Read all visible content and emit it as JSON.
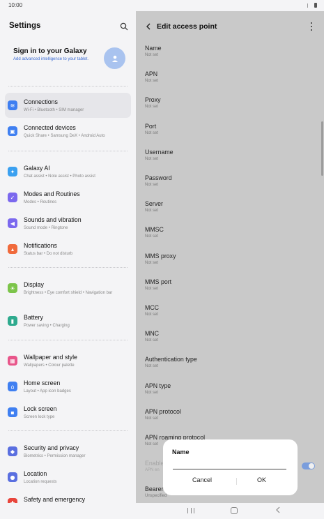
{
  "status": {
    "time": "10:00"
  },
  "left": {
    "title": "Settings",
    "profile": {
      "title": "Sign in to your Galaxy",
      "subtitle": "Add advanced intelligence to your tablet."
    },
    "items": [
      {
        "label": "Connections",
        "sub": "Wi-Fi • Bluetooth • SIM manager",
        "icon": "wifi-icon",
        "color": "#3f7ff1"
      },
      {
        "label": "Connected devices",
        "sub": "Quick Share • Samsung DeX • Android Auto",
        "icon": "devices-icon",
        "color": "#3f7ff1"
      },
      {
        "label": "Galaxy AI",
        "sub": "Chat assist • Note assist • Photo assist",
        "icon": "sparkle-icon",
        "color": "#3aa0f0"
      },
      {
        "label": "Modes and Routines",
        "sub": "Modes • Routines",
        "icon": "check-circle-icon",
        "color": "#7b68ee"
      },
      {
        "label": "Sounds and vibration",
        "sub": "Sound mode • Ringtone",
        "icon": "speaker-icon",
        "color": "#7b68ee"
      },
      {
        "label": "Notifications",
        "sub": "Status bar • Do not disturb",
        "icon": "bell-icon",
        "color": "#f06a3c"
      },
      {
        "label": "Display",
        "sub": "Brightness • Eye comfort shield • Navigation bar",
        "icon": "sun-icon",
        "color": "#7cc44a"
      },
      {
        "label": "Battery",
        "sub": "Power saving • Charging",
        "icon": "battery-icon",
        "color": "#2eaa8e"
      },
      {
        "label": "Wallpaper and style",
        "sub": "Wallpapers • Colour palette",
        "icon": "wallpaper-icon",
        "color": "#e8558a"
      },
      {
        "label": "Home screen",
        "sub": "Layout • App icon badges",
        "icon": "home-icon",
        "color": "#3f7ff1"
      },
      {
        "label": "Lock screen",
        "sub": "Screen lock type",
        "icon": "lock-icon",
        "color": "#3f7ff1"
      },
      {
        "label": "Security and privacy",
        "sub": "Biometrics • Permission manager",
        "icon": "shield-icon",
        "color": "#5a6fe0"
      },
      {
        "label": "Location",
        "sub": "Location requests",
        "icon": "location-icon",
        "color": "#5a6fe0"
      },
      {
        "label": "Safety and emergency",
        "sub": "",
        "icon": "emergency-icon",
        "color": "#e8453c"
      }
    ]
  },
  "right": {
    "title": "Edit access point",
    "fields": [
      {
        "label": "Name",
        "value": "Not set"
      },
      {
        "label": "APN",
        "value": "Not set"
      },
      {
        "label": "Proxy",
        "value": "Not set"
      },
      {
        "label": "Port",
        "value": "Not set"
      },
      {
        "label": "Username",
        "value": "Not set"
      },
      {
        "label": "Password",
        "value": "Not set"
      },
      {
        "label": "Server",
        "value": "Not set"
      },
      {
        "label": "MMSC",
        "value": "Not set"
      },
      {
        "label": "MMS proxy",
        "value": "Not set"
      },
      {
        "label": "MMS port",
        "value": "Not set"
      },
      {
        "label": "MCC",
        "value": "Not set"
      },
      {
        "label": "MNC",
        "value": "Not set"
      },
      {
        "label": "Authentication type",
        "value": "Not set"
      },
      {
        "label": "APN type",
        "value": "Not set"
      },
      {
        "label": "APN protocol",
        "value": "Not set"
      },
      {
        "label": "APN roaming protocol",
        "value": "Not set"
      },
      {
        "label": "Enable",
        "value": "APN en"
      },
      {
        "label": "Bearer",
        "value": "Unspecified"
      }
    ],
    "toggle_on": true
  },
  "dialog": {
    "title": "Name",
    "input_value": "",
    "cancel": "Cancel",
    "ok": "OK"
  }
}
